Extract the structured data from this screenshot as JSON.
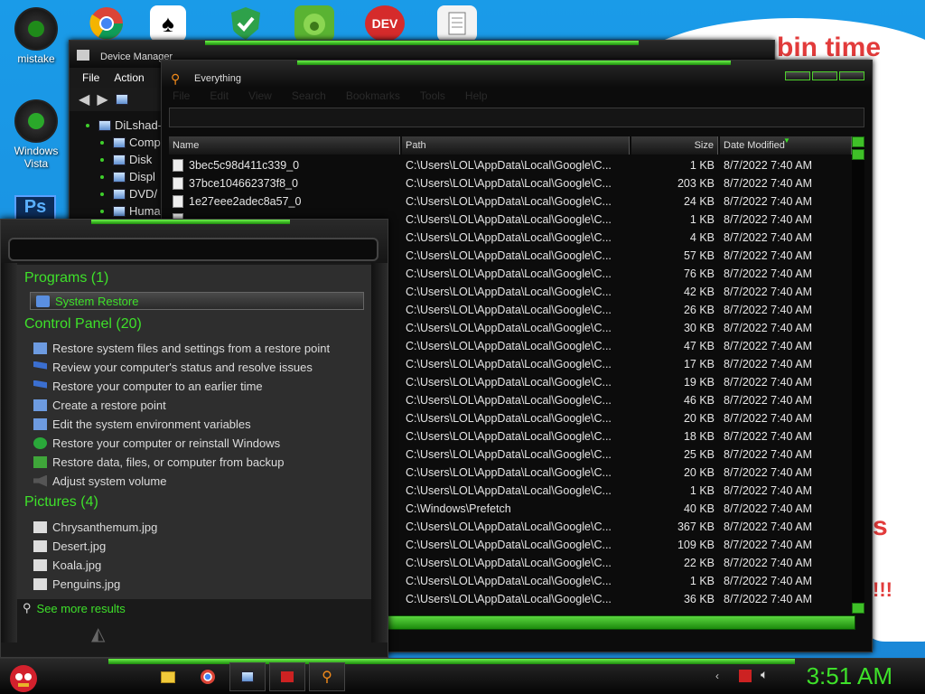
{
  "desktop": {
    "icons": [
      {
        "label": "mistake"
      },
      {
        "label": "Windows Vista"
      }
    ],
    "wallpaper_text": [
      "bin  time",
      "s",
      "!!!"
    ]
  },
  "device_manager": {
    "title": "Device Manager",
    "menu": [
      "File",
      "Action"
    ],
    "tree": [
      "DiLshad-",
      "Comp",
      "Disk",
      "Displ",
      "DVD/",
      "Huma"
    ]
  },
  "everything": {
    "title": "Everything",
    "menu": [
      "File",
      "Edit",
      "View",
      "Search",
      "Bookmarks",
      "Tools",
      "Help"
    ],
    "columns": {
      "name": "Name",
      "path": "Path",
      "size": "Size",
      "date": "Date Modified"
    },
    "rows": [
      {
        "name": "3bec5c98d411c339_0",
        "path": "C:\\Users\\LOL\\AppData\\Local\\Google\\C...",
        "size": "1 KB",
        "date": "8/7/2022 7:40 AM"
      },
      {
        "name": "37bce104662373f8_0",
        "path": "C:\\Users\\LOL\\AppData\\Local\\Google\\C...",
        "size": "203 KB",
        "date": "8/7/2022 7:40 AM"
      },
      {
        "name": "1e27eee2adec8a57_0",
        "path": "C:\\Users\\LOL\\AppData\\Local\\Google\\C...",
        "size": "24 KB",
        "date": "8/7/2022 7:40 AM"
      },
      {
        "name": "",
        "path": "C:\\Users\\LOL\\AppData\\Local\\Google\\C...",
        "size": "1 KB",
        "date": "8/7/2022 7:40 AM"
      },
      {
        "name": "",
        "path": "C:\\Users\\LOL\\AppData\\Local\\Google\\C...",
        "size": "4 KB",
        "date": "8/7/2022 7:40 AM"
      },
      {
        "name": "",
        "path": "C:\\Users\\LOL\\AppData\\Local\\Google\\C...",
        "size": "57 KB",
        "date": "8/7/2022 7:40 AM"
      },
      {
        "name": "",
        "path": "C:\\Users\\LOL\\AppData\\Local\\Google\\C...",
        "size": "76 KB",
        "date": "8/7/2022 7:40 AM"
      },
      {
        "name": "",
        "path": "C:\\Users\\LOL\\AppData\\Local\\Google\\C...",
        "size": "42 KB",
        "date": "8/7/2022 7:40 AM"
      },
      {
        "name": "",
        "path": "C:\\Users\\LOL\\AppData\\Local\\Google\\C...",
        "size": "26 KB",
        "date": "8/7/2022 7:40 AM"
      },
      {
        "name": "",
        "path": "C:\\Users\\LOL\\AppData\\Local\\Google\\C...",
        "size": "30 KB",
        "date": "8/7/2022 7:40 AM"
      },
      {
        "name": "",
        "path": "C:\\Users\\LOL\\AppData\\Local\\Google\\C...",
        "size": "47 KB",
        "date": "8/7/2022 7:40 AM"
      },
      {
        "name": "",
        "path": "C:\\Users\\LOL\\AppData\\Local\\Google\\C...",
        "size": "17 KB",
        "date": "8/7/2022 7:40 AM"
      },
      {
        "name": "",
        "path": "C:\\Users\\LOL\\AppData\\Local\\Google\\C...",
        "size": "19 KB",
        "date": "8/7/2022 7:40 AM"
      },
      {
        "name": "",
        "path": "C:\\Users\\LOL\\AppData\\Local\\Google\\C...",
        "size": "46 KB",
        "date": "8/7/2022 7:40 AM"
      },
      {
        "name": "",
        "path": "C:\\Users\\LOL\\AppData\\Local\\Google\\C...",
        "size": "20 KB",
        "date": "8/7/2022 7:40 AM"
      },
      {
        "name": "",
        "path": "C:\\Users\\LOL\\AppData\\Local\\Google\\C...",
        "size": "18 KB",
        "date": "8/7/2022 7:40 AM"
      },
      {
        "name": "",
        "path": "C:\\Users\\LOL\\AppData\\Local\\Google\\C...",
        "size": "25 KB",
        "date": "8/7/2022 7:40 AM"
      },
      {
        "name": "",
        "path": "C:\\Users\\LOL\\AppData\\Local\\Google\\C...",
        "size": "20 KB",
        "date": "8/7/2022 7:40 AM"
      },
      {
        "name": "",
        "path": "C:\\Users\\LOL\\AppData\\Local\\Google\\C...",
        "size": "1 KB",
        "date": "8/7/2022 7:40 AM"
      },
      {
        "name": "",
        "path": "C:\\Windows\\Prefetch",
        "size": "40 KB",
        "date": "8/7/2022 7:40 AM"
      },
      {
        "name": "",
        "path": "C:\\Users\\LOL\\AppData\\Local\\Google\\C...",
        "size": "367 KB",
        "date": "8/7/2022 7:40 AM"
      },
      {
        "name": "",
        "path": "C:\\Users\\LOL\\AppData\\Local\\Google\\C...",
        "size": "109 KB",
        "date": "8/7/2022 7:40 AM"
      },
      {
        "name": "",
        "path": "C:\\Users\\LOL\\AppData\\Local\\Google\\C...",
        "size": "22 KB",
        "date": "8/7/2022 7:40 AM"
      },
      {
        "name": "",
        "path": "C:\\Users\\LOL\\AppData\\Local\\Google\\C...",
        "size": "1 KB",
        "date": "8/7/2022 7:40 AM"
      },
      {
        "name": "",
        "path": "C:\\Users\\LOL\\AppData\\Local\\Google\\C...",
        "size": "36 KB",
        "date": "8/7/2022 7:40 AM"
      }
    ]
  },
  "start_menu": {
    "categories": {
      "programs": "Programs (1)",
      "control_panel": "Control Panel (20)",
      "pictures": "Pictures (4)"
    },
    "programs": [
      "System Restore"
    ],
    "control_panel": [
      "Restore system files and settings from a restore point",
      "Review your computer's status and resolve issues",
      "Restore your computer to an earlier time",
      "Create a restore point",
      "Edit the system environment variables",
      "Restore your computer or reinstall Windows",
      "Restore data, files, or computer from backup",
      "Adjust system volume"
    ],
    "pictures": [
      "Chrysanthemum.jpg",
      "Desert.jpg",
      "Koala.jpg",
      "Penguins.jpg"
    ],
    "see_more": "See more results"
  },
  "taskbar": {
    "clock": "3:51 AM"
  },
  "colors": {
    "accent": "#3ee02a",
    "chrome": "#111111",
    "desktop": "#1a9be8"
  }
}
